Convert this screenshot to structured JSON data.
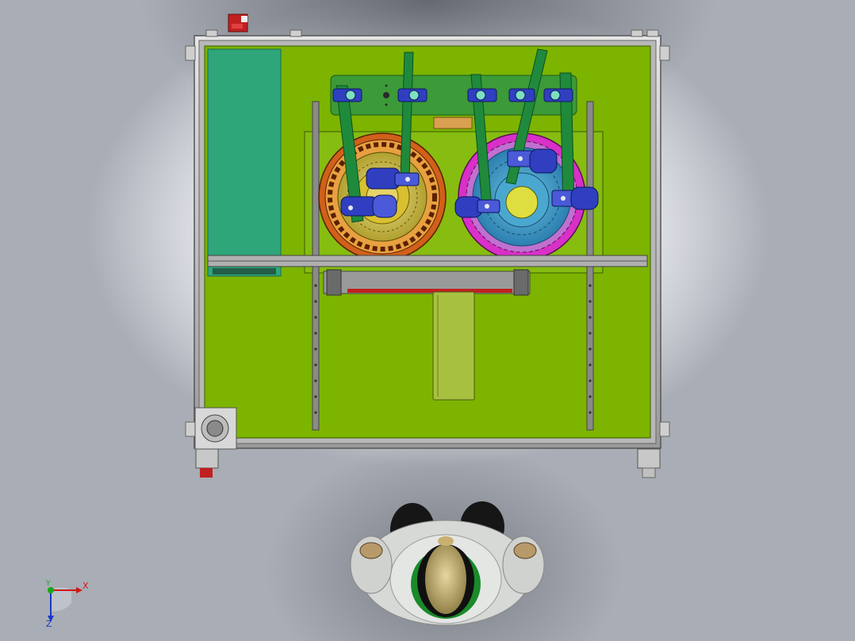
{
  "viewport": {
    "background_gradient": [
      "#ffffff",
      "#a9adb5"
    ]
  },
  "colors": {
    "frame": "#c8c8c8",
    "frame_dark": "#7a7a7a",
    "base_plate": "#7cb400",
    "base_plate_light": "#8fcc10",
    "control_panel": "#2ea67a",
    "mount_bar": "#3c9a38",
    "tube": "#1f8a3c",
    "actuator_blue": "#2f3fc0",
    "ring_orange": "#e0601a",
    "ring_yellow": "#d8c030",
    "ring_magenta": "#d830c8",
    "disk_blue": "#3ca0d0",
    "operator_suit": "#d8dcd8",
    "operator_hair": "#111111"
  },
  "triad": {
    "x_label": "X",
    "y_label": "Y",
    "z_label": "Z",
    "x_color": "#d01818",
    "y_color": "#18a818",
    "z_color": "#1838c8"
  },
  "scene": {
    "view": "top",
    "objects": [
      "machine-frame",
      "left-rotary-table",
      "right-rotary-table",
      "swing-arm-tubes",
      "linear-slide",
      "emergency-stop",
      "operator-figure"
    ]
  }
}
